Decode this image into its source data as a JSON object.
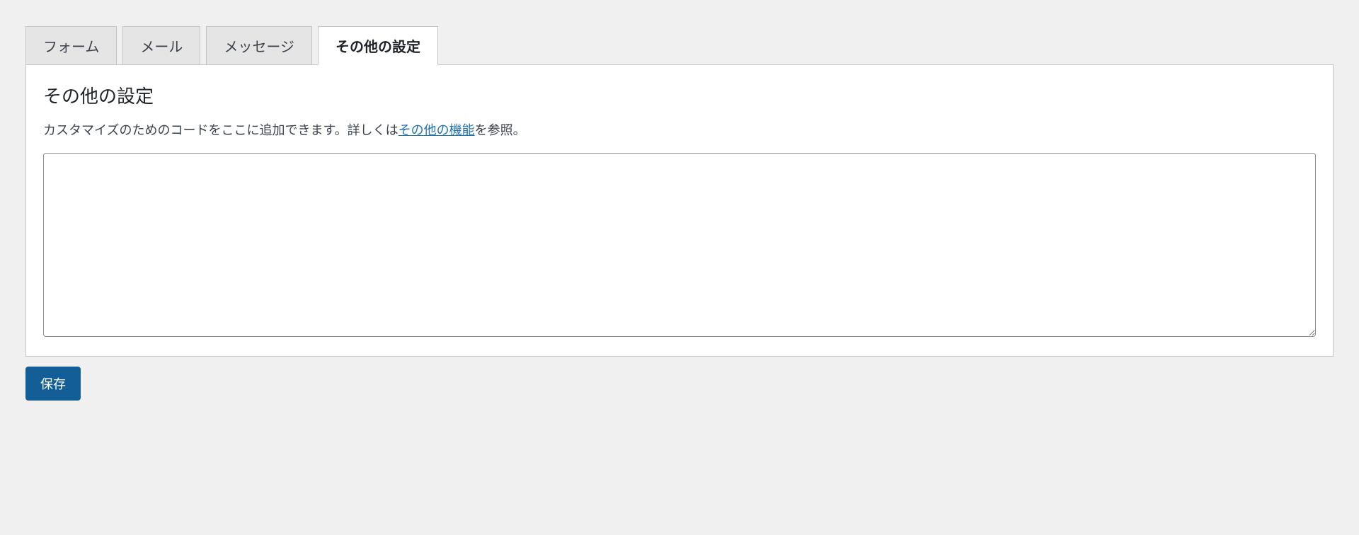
{
  "tabs": [
    {
      "label": "フォーム",
      "active": false
    },
    {
      "label": "メール",
      "active": false
    },
    {
      "label": "メッセージ",
      "active": false
    },
    {
      "label": "その他の設定",
      "active": true
    }
  ],
  "panel": {
    "heading": "その他の設定",
    "help_prefix": "カスタマイズのためのコードをここに追加できます。詳しくは",
    "help_link": "その他の機能",
    "help_suffix": "を参照。",
    "textarea_value": ""
  },
  "actions": {
    "save_label": "保存"
  }
}
